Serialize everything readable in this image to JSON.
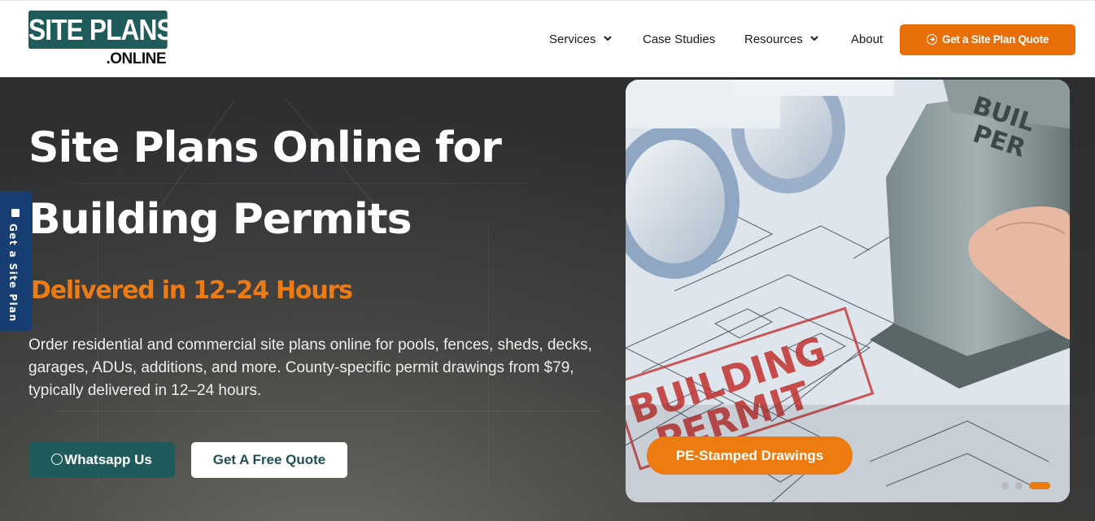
{
  "brand": {
    "logo_main": "SITE PLANS",
    "logo_sub": ".ONLINE"
  },
  "nav": {
    "items": [
      {
        "label": "Services",
        "has_dropdown": true
      },
      {
        "label": "Case Studies",
        "has_dropdown": false
      },
      {
        "label": "Resources",
        "has_dropdown": true
      },
      {
        "label": "About",
        "has_dropdown": false
      }
    ],
    "cta_label": "Get a Site Plan Quote"
  },
  "hero": {
    "title_line1": "Site Plans Online for",
    "title_line2": "Building Permits",
    "subtitle": "Delivered in 12–24 Hours",
    "description": "Order residential and commercial site plans online for pools, fences, sheds, decks, garages, ADUs, additions, and more. County-specific permit drawings from $79, typically delivered in 12–24 hours.",
    "whatsapp_label": "Whatsapp Us",
    "quote_label": "Get A Free Quote"
  },
  "side_tab": {
    "label": "Get a Site Plan"
  },
  "carousel": {
    "badge_label": "PE-Stamped Drawings",
    "photo_text_stamp": "BUILDING PERMIT",
    "photo_text_stamper": "BUIL PER",
    "slide_count": 3,
    "active_slide": 3
  },
  "colors": {
    "brand_teal": "#1f5b5b",
    "accent_orange": "#e86f08",
    "side_tab_blue": "#163e72"
  }
}
